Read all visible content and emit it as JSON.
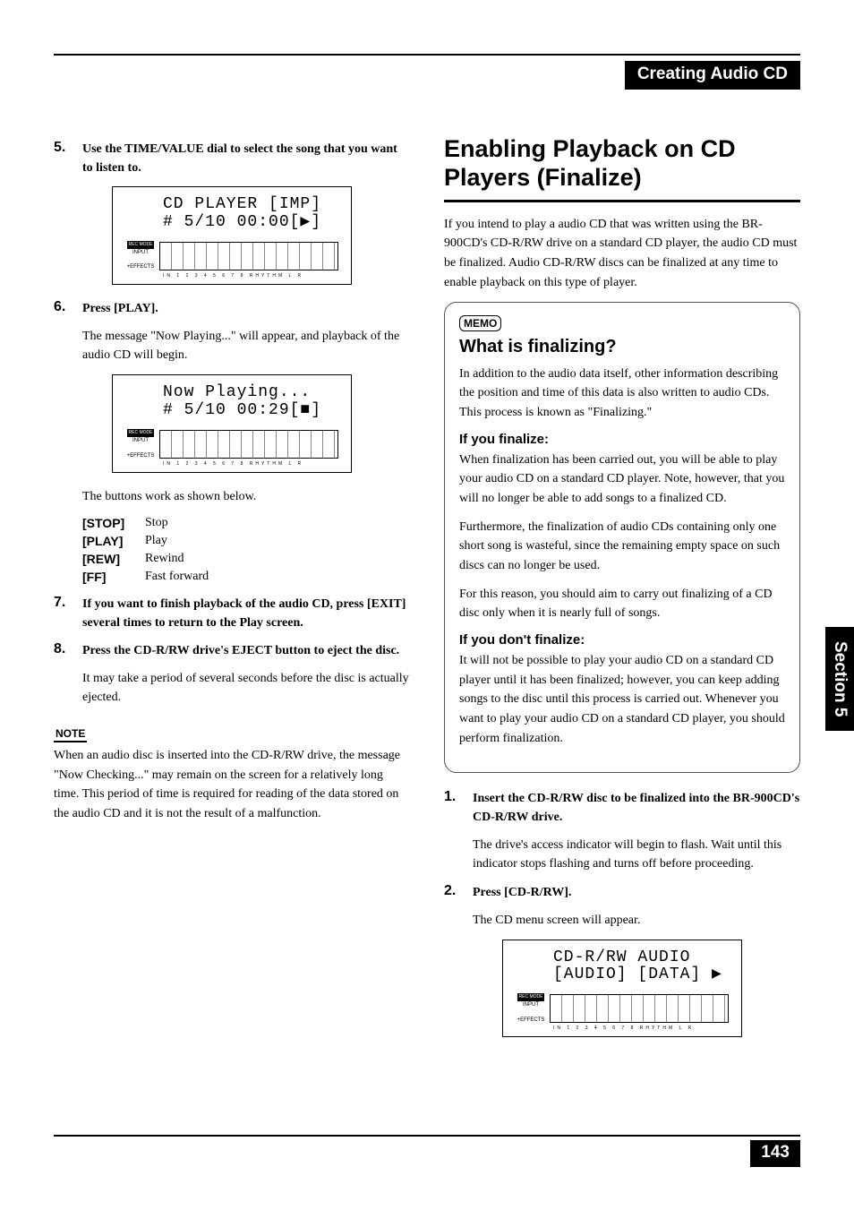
{
  "header": {
    "title": "Creating Audio CD"
  },
  "side_tab": "Section 5",
  "page_number": "143",
  "left": {
    "step5": {
      "num": "5.",
      "text": "Use the TIME/VALUE dial to select the song that you want to listen to."
    },
    "lcd1": {
      "line1": "CD PLAYER  [IMP]",
      "line2": "# 5/10  00:00[▶]",
      "rec_mode": "REC MODE",
      "input": "INPUT",
      "effects": "+EFFECTS",
      "scale": "IN    1  2  3  4  5  6  7  8 RHYTHM    L  R"
    },
    "step6": {
      "num": "6.",
      "text": "Press [PLAY].",
      "body": "The message \"Now Playing...\" will appear, and playback of the audio CD will begin."
    },
    "lcd2": {
      "line1": "Now Playing...",
      "line2": "# 5/10  00:29[■]"
    },
    "after_lcd2": "The buttons work as shown below.",
    "buttons": [
      {
        "label": "[STOP]",
        "desc": "Stop"
      },
      {
        "label": "[PLAY]",
        "desc": "Play"
      },
      {
        "label": "[REW]",
        "desc": "Rewind"
      },
      {
        "label": "[FF]",
        "desc": "Fast forward"
      }
    ],
    "step7": {
      "num": "7.",
      "text": "If you want to finish playback of the audio CD, press [EXIT] several times to return to the Play screen."
    },
    "step8": {
      "num": "8.",
      "text": "Press the CD-R/RW drive's EJECT button to eject the disc.",
      "body": "It may take a period of several seconds before the disc is actually ejected."
    },
    "note": {
      "label": "NOTE",
      "body": "When an audio disc is inserted into the CD-R/RW drive, the message \"Now Checking...\" may remain on the screen for a relatively long time. This period of time is required for reading of the data stored on the audio CD and it is not the result of a malfunction."
    }
  },
  "right": {
    "h2": "Enabling Playback on CD Players (Finalize)",
    "intro": "If you intend to play a audio CD that was written using the BR-900CD's CD-R/RW drive on a standard CD player, the audio CD must be finalized. Audio CD-R/RW discs can be finalized at any time to enable playback on this type of player.",
    "memo": {
      "label": "MEMO",
      "h3": "What is finalizing?",
      "p1": "In addition to the audio data itself, other information describing the position and time of this data is also written to audio CDs. This process is known as \"Finalizing.\"",
      "h4a": "If you finalize:",
      "p2": "When finalization has been carried out, you will be able to play your audio CD on a standard CD player. Note, however, that you will no longer be able to add songs to a finalized CD.",
      "p3": "Furthermore, the finalization of audio CDs containing only one short song is wasteful, since the remaining empty space on such discs can no longer be used.",
      "p4": "For this reason, you should aim to carry out finalizing of a CD disc only when it is nearly full of songs.",
      "h4b": "If you don't finalize:",
      "p5": "It will not be possible to play your audio CD on a standard CD player until it has been finalized; however, you can keep adding songs to the disc until this process is carried out. Whenever you want to play your audio CD on a standard CD player, you should perform finalization."
    },
    "step1": {
      "num": "1.",
      "text": "Insert the CD-R/RW disc to be finalized into the BR-900CD's CD-R/RW drive.",
      "body": "The drive's access indicator will begin to flash. Wait until this indicator stops flashing and turns off before proceeding."
    },
    "step2": {
      "num": "2.",
      "text": "Press [CD-R/RW].",
      "body": "The CD menu screen will appear."
    },
    "lcd3": {
      "line1": "CD-R/RW    AUDIO",
      "line2": "[AUDIO] [DATA] ▶"
    }
  }
}
